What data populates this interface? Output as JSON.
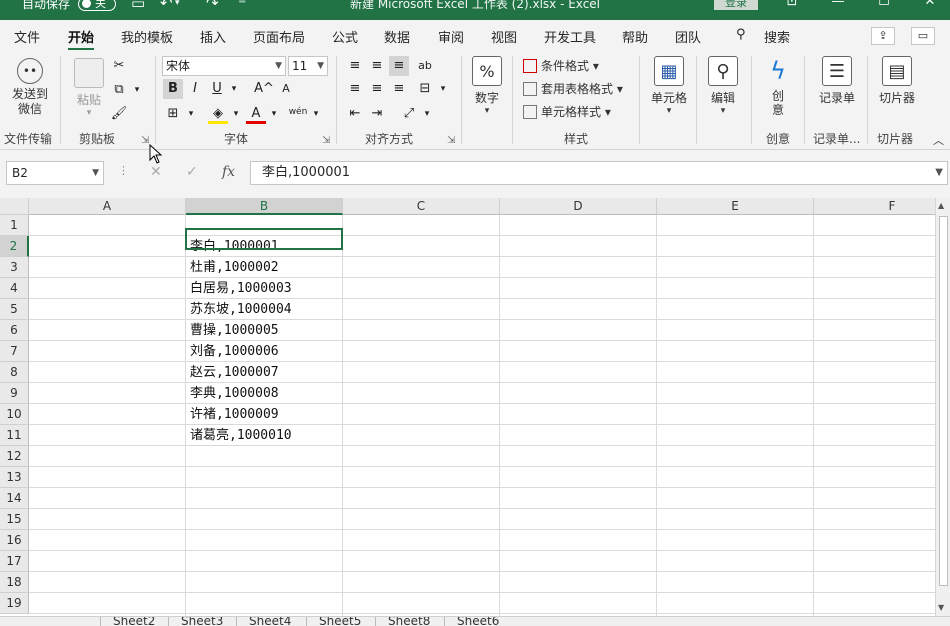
{
  "titlebar": {
    "autosave_label": "自动保存",
    "autosave_state": "关",
    "doc_title": "新建 Microsoft Excel 工作表 (2).xlsx  -  Excel",
    "login_label": "登录"
  },
  "tabs": [
    {
      "label": "文件"
    },
    {
      "label": "开始"
    },
    {
      "label": "我的模板"
    },
    {
      "label": "插入"
    },
    {
      "label": "页面布局"
    },
    {
      "label": "公式"
    },
    {
      "label": "数据"
    },
    {
      "label": "审阅"
    },
    {
      "label": "视图"
    },
    {
      "label": "开发工具"
    },
    {
      "label": "帮助"
    },
    {
      "label": "团队"
    }
  ],
  "search_label": "搜索",
  "ribbon": {
    "send_wechat": "发送到微信",
    "group_file_transfer": "文件传输",
    "paste": "粘贴",
    "group_clipboard": "剪贴板",
    "font_name": "宋体",
    "font_size": "11",
    "bold": "B",
    "italic": "I",
    "underline": "U",
    "grow": "A^",
    "shrink": "A",
    "phonetic": "wén",
    "group_font": "字体",
    "group_alignment": "对齐方式",
    "number": "数字",
    "percent_symbol": "%",
    "cond_format": "条件格式",
    "table_format": "套用表格格式",
    "cell_style": "单元格样式",
    "group_styles": "样式",
    "cells": "单元格",
    "editing": "编辑",
    "create": "创意",
    "group_create": "创意",
    "record_sheet": "记录单",
    "group_record": "记录单...",
    "slicer": "切片器",
    "group_slicer": "切片器"
  },
  "formula_bar": {
    "name_box": "B2",
    "cancel": "✕",
    "enter": "✓",
    "fx": "fx",
    "content": "李白,1000001"
  },
  "grid": {
    "columns": [
      "A",
      "B",
      "C",
      "D",
      "E",
      "F"
    ],
    "rows": [
      "1",
      "2",
      "3",
      "4",
      "5",
      "6",
      "7",
      "8",
      "9",
      "10",
      "11",
      "12",
      "13",
      "14",
      "15",
      "16",
      "17",
      "18",
      "19"
    ],
    "cells_B": [
      "",
      "李白,1000001",
      "杜甫,1000002",
      "白居易,1000003",
      "苏东坡,1000004",
      "曹操,1000005",
      "刘备,1000006",
      "赵云,1000007",
      "李典,1000008",
      "许褚,1000009",
      "诸葛亮,1000010"
    ]
  },
  "sheets": [
    "Sheet2",
    "Sheet3",
    "Sheet4",
    "Sheet5",
    "Sheet8",
    "Sheet6"
  ],
  "colors": {
    "accent": "#217346",
    "ribbon_bg": "#f3f3f3",
    "grid_line": "#dadada",
    "header_bg": "#e9e9e9"
  }
}
